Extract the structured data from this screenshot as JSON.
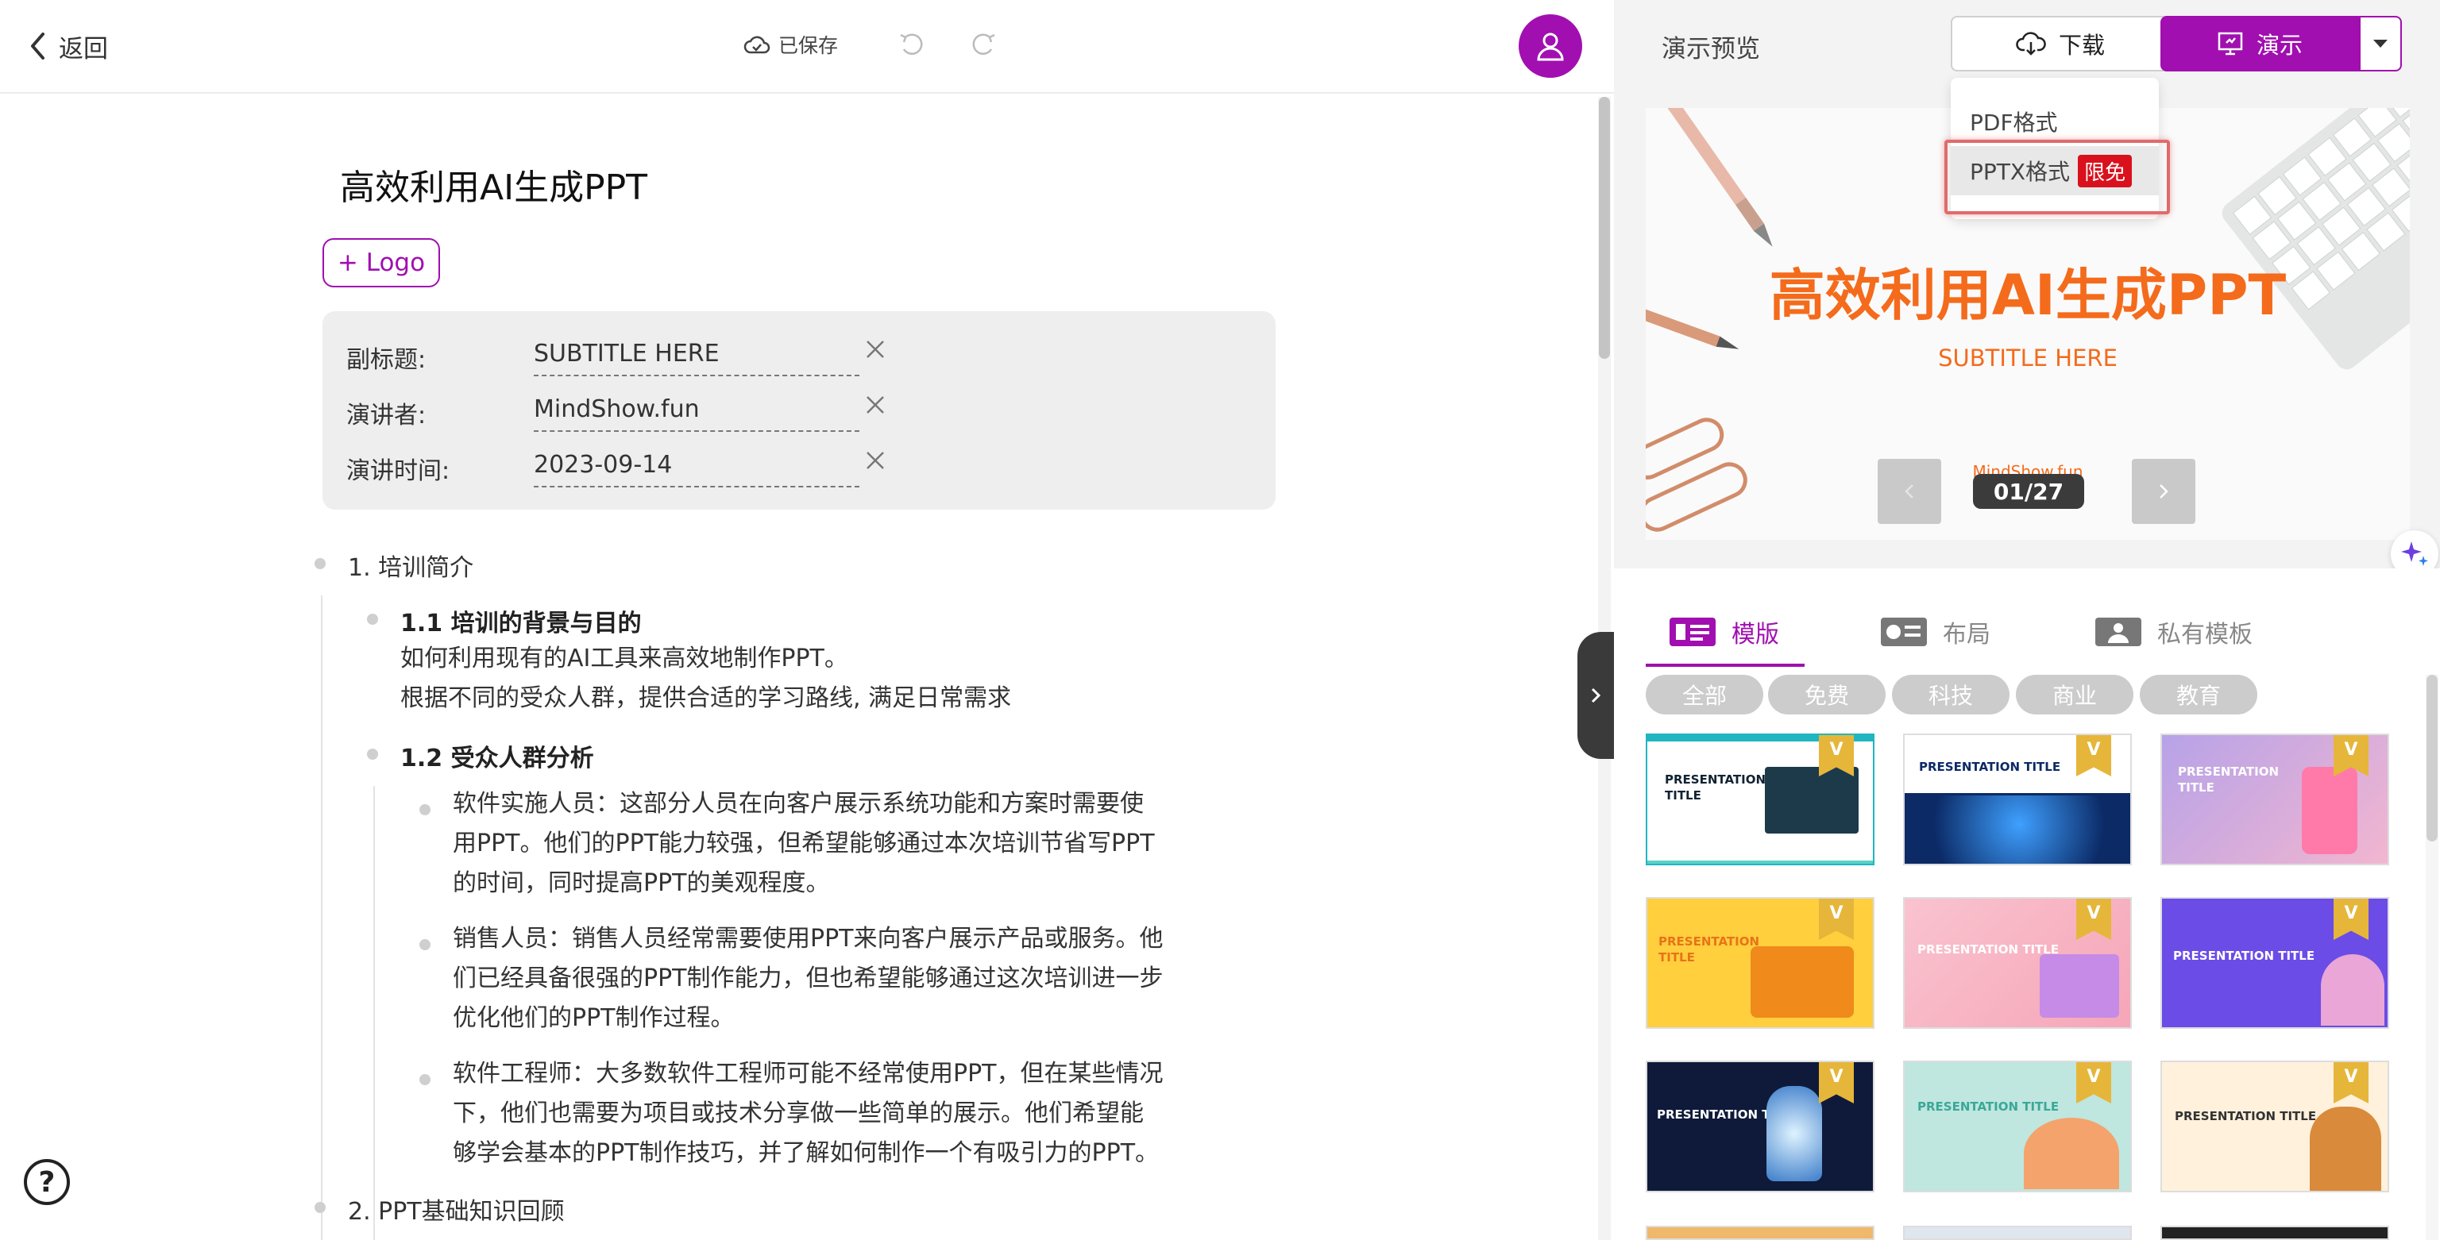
{
  "topbar": {
    "back_label": "返回",
    "saved_label": "已保存"
  },
  "doc": {
    "title": "高效利用AI生成PPT",
    "logo_button": "+ Logo",
    "meta": [
      {
        "label": "副标题:",
        "value": "SUBTITLE HERE"
      },
      {
        "label": "演讲者:",
        "value": "MindShow.fun"
      },
      {
        "label": "演讲时间:",
        "value": "2023-09-14"
      }
    ],
    "outline": {
      "s1": "1. 培训简介",
      "s1_1": "1.1 培训的背景与目的",
      "s1_1_p1": "如何利用现有的AI工具来高效地制作PPT。",
      "s1_1_p2": "根据不同的受众人群，提供合适的学习路线, 满足日常需求",
      "s1_2": "1.2 受众人群分析",
      "b1_l1": "软件实施人员：这部分人员在向客户展示系统功能和方案时需要使",
      "b1_l2": "用PPT。他们的PPT能力较强，但希望能够通过本次培训节省写PPT",
      "b1_l3": "的时间，同时提高PPT的美观程度。",
      "b2_l1": "销售人员：销售人员经常需要使用PPT来向客户展示产品或服务。他",
      "b2_l2": "们已经具备很强的PPT制作能力，但也希望能够通过这次培训进一步",
      "b2_l3": "优化他们的PPT制作过程。",
      "b3_l1": "软件工程师：大多数软件工程师可能不经常使用PPT，但在某些情况",
      "b3_l2": "下，他们也需要为项目或技术分享做一些简单的展示。他们希望能",
      "b3_l3": "够学会基本的PPT制作技巧，并了解如何制作一个有吸引力的PPT。",
      "s2": "2. PPT基础知识回顾"
    }
  },
  "preview": {
    "label": "演示预览",
    "download_label": "下载",
    "present_label": "演示",
    "download_menu": {
      "pdf": "PDF格式",
      "pptx": "PPTX格式",
      "pptx_badge": "限免"
    },
    "slide": {
      "title": "高效利用AI生成PPT",
      "subtitle": "SUBTITLE HERE",
      "author": "MindShow.fun",
      "counter": "01/27"
    }
  },
  "templates": {
    "tabs": [
      "模版",
      "布局",
      "私有模板"
    ],
    "active_tab": "模版",
    "filters": [
      "全部",
      "免费",
      "科技",
      "商业",
      "教育"
    ],
    "items": [
      {
        "title": "PRESENTATION TITLE",
        "bg": "#ffffff",
        "accent": "#1fb6c1"
      },
      {
        "title": "PRESENTATION TITLE",
        "bg": "#0b2a66",
        "accent": "#ffffff"
      },
      {
        "title": "PRESENTATION TITLE",
        "bg": "#c9a7e6",
        "accent": "#ffffff"
      },
      {
        "title": "PRESENTATION TITLE",
        "bg": "#ffcf3d",
        "accent": "#f08a1a"
      },
      {
        "title": "PRESENTATION TITLE",
        "bg": "#f7b6c6",
        "accent": "#ffffff"
      },
      {
        "title": "PRESENTATION TITLE",
        "bg": "#6b4ce6",
        "accent": "#ffffff"
      },
      {
        "title": "PRESENTATION TITLE",
        "bg": "#0f1a3a",
        "accent": "#ffffff"
      },
      {
        "title": "PRESENTATION TITLE",
        "bg": "#bfe6df",
        "accent": "#3aa898"
      },
      {
        "title": "PRESENTATION TITLE",
        "bg": "#fff1dc",
        "accent": "#333333"
      }
    ],
    "badge": "V"
  },
  "colors": {
    "brand": "#a10fb0",
    "slide_accent": "#f46b1c",
    "badge_red": "#d9111d"
  }
}
